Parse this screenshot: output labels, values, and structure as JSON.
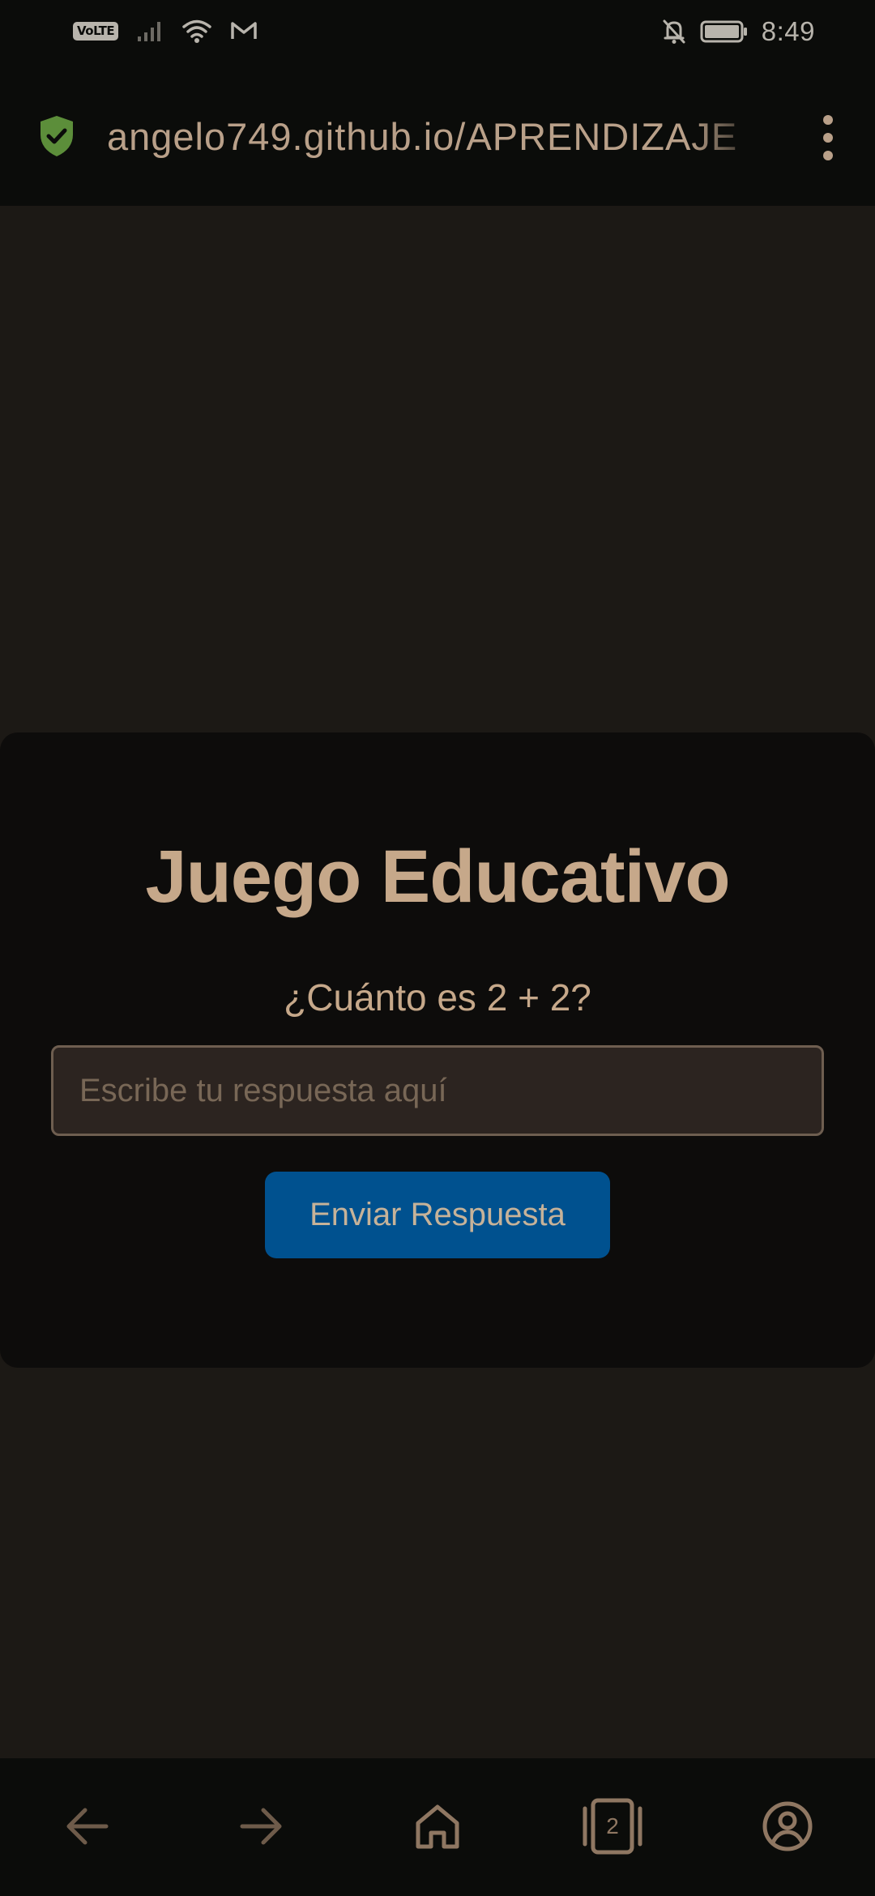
{
  "status_bar": {
    "network_badge": "VoLTE",
    "time": "8:49",
    "icons": [
      "signal-icon",
      "wifi-icon",
      "gmail-icon",
      "mute-notifications-icon",
      "battery-icon"
    ]
  },
  "browser": {
    "url": "angelo749.github.io/APRENDIZAJE",
    "security_icon": "shield-check-icon",
    "menu_icon": "more-vert-icon",
    "shield_color": "#5c8e3a"
  },
  "game": {
    "title": "Juego Educativo",
    "question": "¿Cuánto es 2 + 2?",
    "answer_placeholder": "Escribe tu respuesta aquí",
    "answer_value": "",
    "submit_label": "Enviar Respuesta",
    "button_color": "#00518f"
  },
  "bottom_nav": {
    "items": [
      "back-icon",
      "forward-icon",
      "home-icon",
      "tabs-icon",
      "account-icon"
    ],
    "tab_count": "2"
  }
}
